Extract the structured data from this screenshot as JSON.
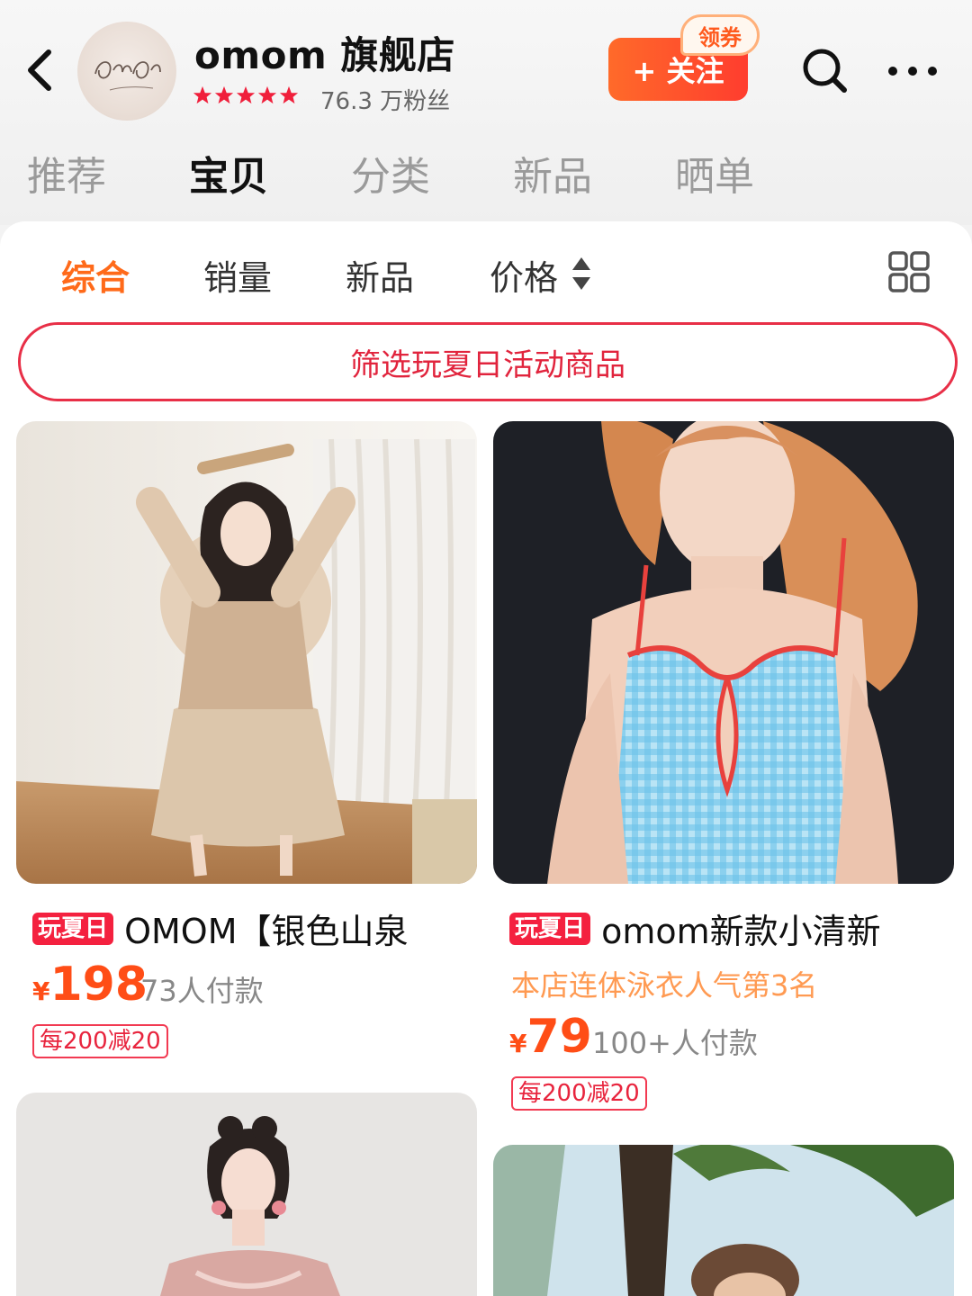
{
  "header": {
    "store_name": "omom 旗舰店",
    "fans": "76.3 万粉丝",
    "rating_stars": 5,
    "follow_label": "+ 关注",
    "coupon_label": "领券"
  },
  "top_tabs": [
    {
      "label": "推荐",
      "active": false
    },
    {
      "label": "宝贝",
      "active": true
    },
    {
      "label": "分类",
      "active": false
    },
    {
      "label": "新品",
      "active": false
    },
    {
      "label": "晒单",
      "active": false
    }
  ],
  "sort": {
    "items": [
      {
        "label": "综合",
        "active": true
      },
      {
        "label": "销量",
        "active": false
      },
      {
        "label": "新品",
        "active": false
      },
      {
        "label": "价格",
        "active": false
      }
    ]
  },
  "filter_label": "筛选玩夏日活动商品",
  "products": [
    {
      "tag": "玩夏日",
      "title": "OMOM【银色山泉",
      "rank": "",
      "currency": "¥",
      "price": "198",
      "sales": "73人付款",
      "promo": "每200减20"
    },
    {
      "tag": "玩夏日",
      "title": "omom新款小清新",
      "rank": "本店连体泳衣人气第3名",
      "currency": "¥",
      "price": "79",
      "sales": "100+人付款",
      "promo": "每200减20"
    }
  ],
  "colors": {
    "accent_orange": "#ff6a1a",
    "tag_red": "#f4213f",
    "price": "#ff4d16",
    "filter_border": "#e82f47"
  },
  "icons": [
    "back-icon",
    "search-icon",
    "more-icon",
    "sort-arrows-icon",
    "grid-view-icon",
    "star-icon"
  ]
}
